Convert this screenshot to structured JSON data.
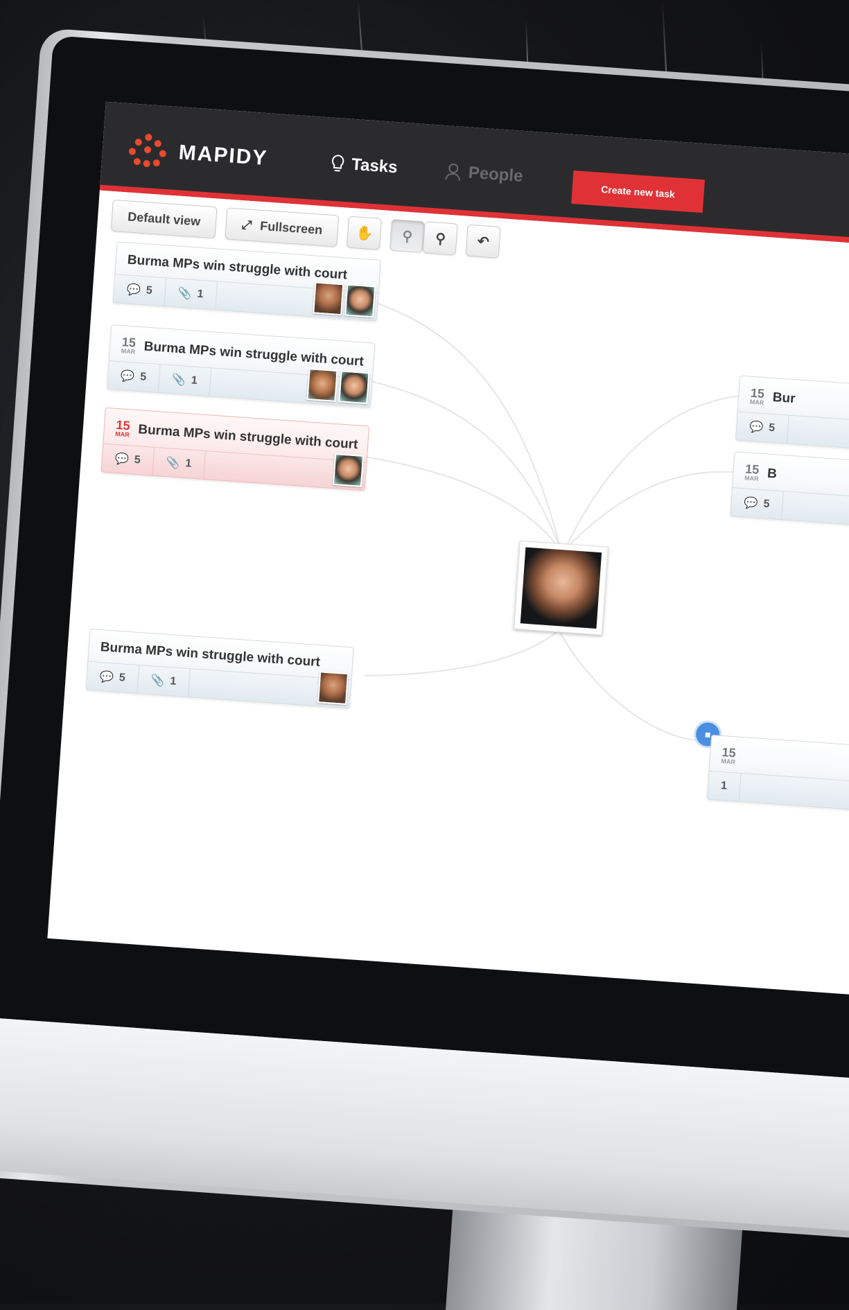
{
  "app": {
    "brand": "MAPIDY",
    "nav": {
      "tasks": "Tasks",
      "people": "People"
    },
    "create_button": "Create new task"
  },
  "toolbar": {
    "default_view": "Default view",
    "fullscreen": "Fullscreen",
    "icons": [
      "hand-icon",
      "zoom-out-icon",
      "zoom-in-icon",
      "undo-icon"
    ]
  },
  "cards": [
    {
      "title": "Burma MPs win struggle with court",
      "comments": "5",
      "attachments": "1"
    },
    {
      "day": "15",
      "month": "MAR",
      "title": "Burma MPs win struggle with court",
      "comments": "5",
      "attachments": "1"
    },
    {
      "day": "15",
      "month": "MAR",
      "title": "Burma MPs win struggle with court",
      "comments": "5",
      "attachments": "1"
    },
    {
      "title": "Burma MPs win struggle with court",
      "comments": "5",
      "attachments": "1"
    }
  ],
  "right_cards": [
    {
      "day": "15",
      "month": "MAR",
      "title_fragment": "Bur",
      "comments": "5"
    },
    {
      "day": "15",
      "month": "MAR",
      "title_fragment": "B",
      "comments": "5"
    },
    {
      "day": "15",
      "month": "MAR",
      "comments": "1"
    }
  ],
  "colors": {
    "accent": "#e03236",
    "topbar": "#2b2b2d",
    "link": "#4a8fe0"
  }
}
